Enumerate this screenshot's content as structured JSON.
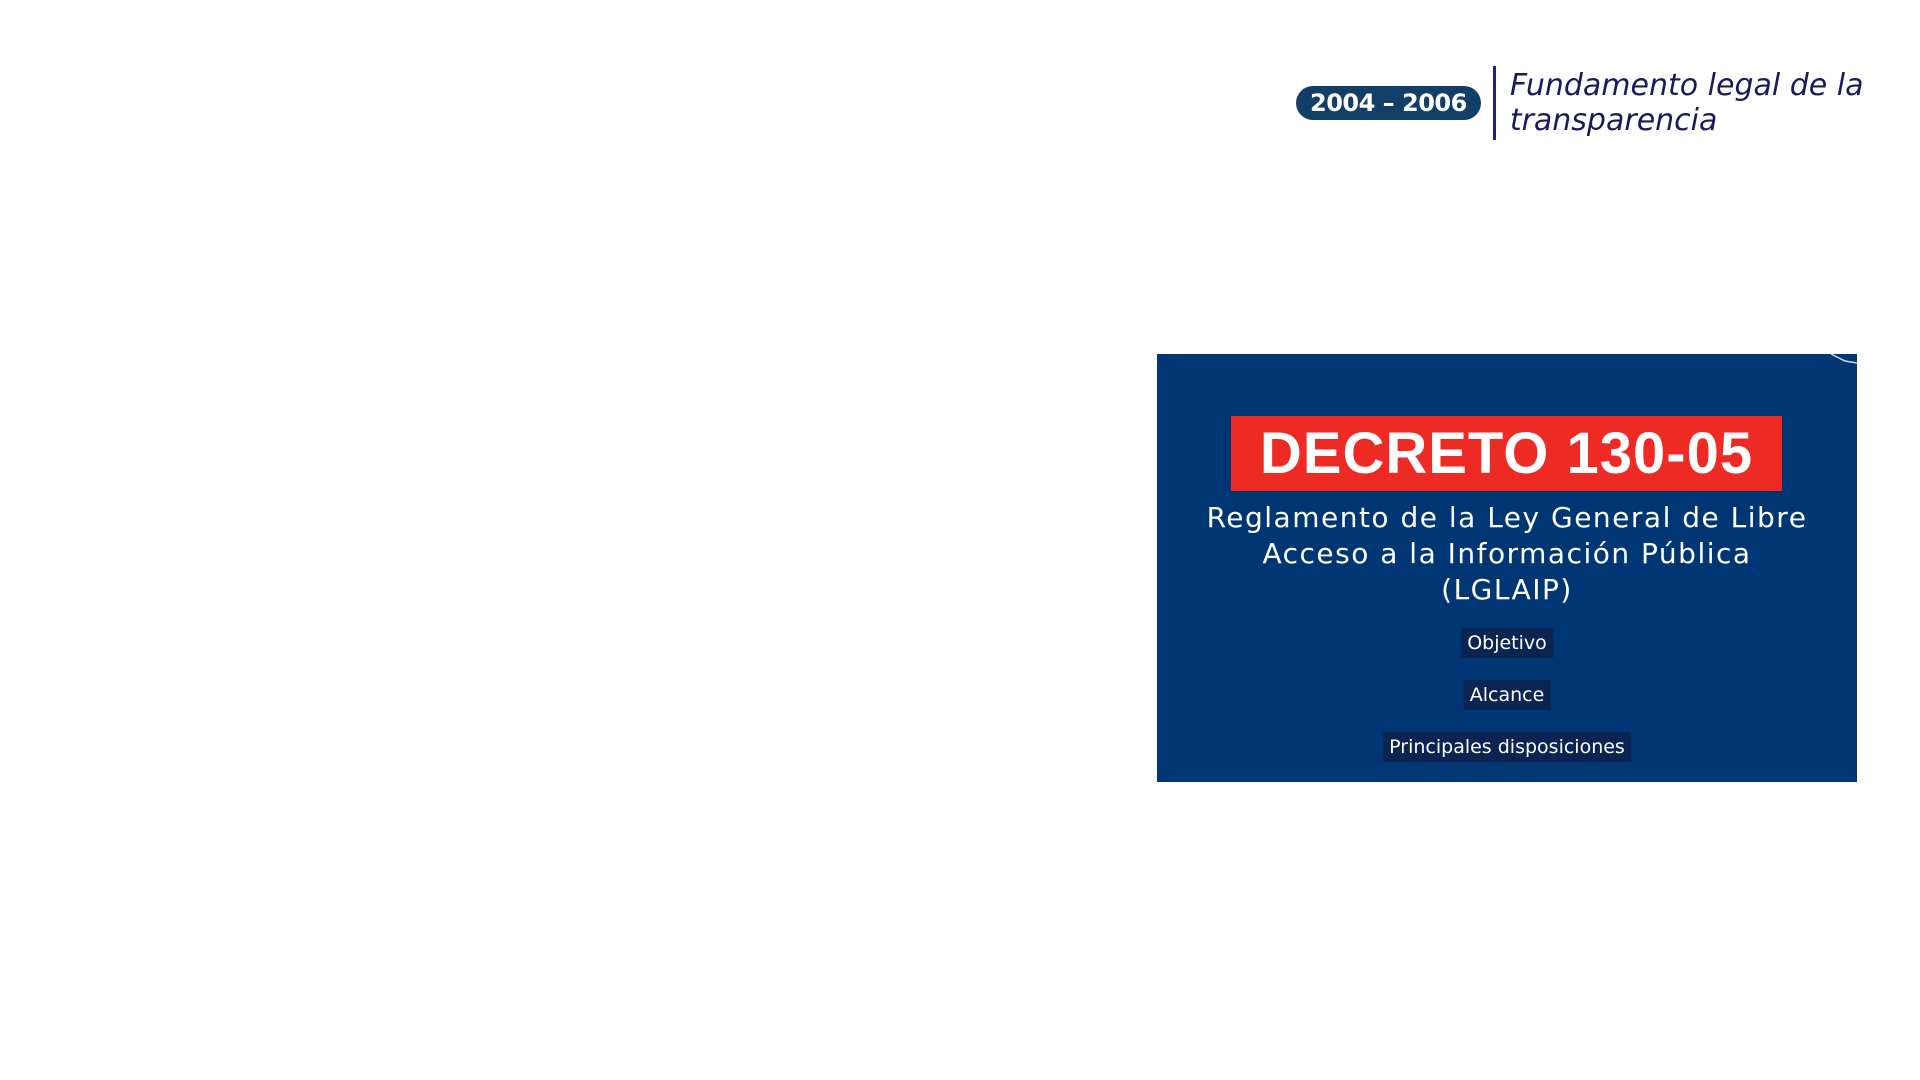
{
  "header": {
    "period": "2004 – 2006",
    "title": "Fundamento legal de la transparencia"
  },
  "card": {
    "decree": "DECRETO 130-05",
    "subtitle": "Reglamento de la Ley General de Libre Acceso a la Información Pública (LGLAIP)",
    "tags": [
      "Objetivo",
      "Alcance",
      "Principales disposiciones"
    ]
  },
  "colors": {
    "card_background": "#003673",
    "decree_red": "#ee2a24",
    "badge_blue": "#123e68",
    "tag_background": "#0b2451",
    "divider": "#1f1f86"
  }
}
